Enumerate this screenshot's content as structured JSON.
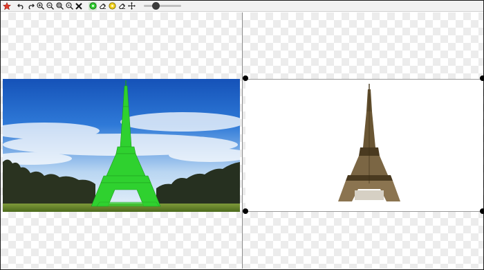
{
  "toolbar": {
    "items": [
      "app-logo",
      "undo",
      "redo",
      "zoom-in",
      "zoom-out",
      "zoom-fit",
      "zoom-actual",
      "clear",
      "mark-foreground",
      "erase",
      "mark-background",
      "erase-background",
      "move"
    ],
    "active_tool": "mark-foreground"
  },
  "colors": {
    "foreground_mark": "#2fd12f",
    "background_mark": "#f2d21a",
    "sky_top": "#1f6fd0",
    "sky_bottom": "#dcebf8",
    "trees": "#2f3a22",
    "grass": "#6b8a2e",
    "tower": "#8a7550"
  }
}
